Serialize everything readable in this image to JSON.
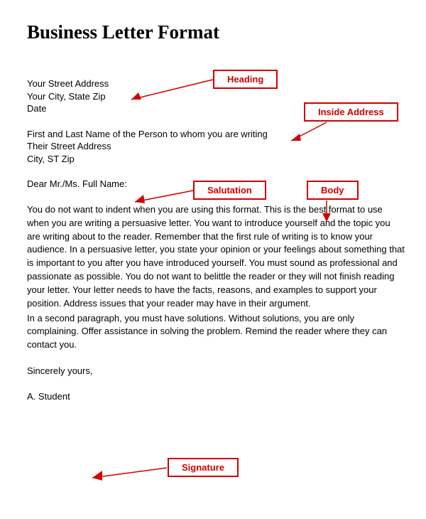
{
  "title": "Business Letter Format",
  "heading": {
    "line1": "Your Street Address",
    "line2": "Your City, State  Zip",
    "line3": "Date"
  },
  "inside_address": {
    "line1": "First and Last Name of the Person to whom you are writing",
    "line2": "Their Street Address",
    "line3": "City, ST Zip"
  },
  "salutation": "Dear Mr./Ms. Full Name:",
  "body": {
    "p1": "You do not want to indent when you are using this format.  This is the best format to use when you are writing a persuasive letter.    You want to introduce yourself and the topic you are writing about to the reader.  Remember that the first rule of writing is to know your audience.  In a persuasive letter, you state your opinion or your feelings about something that is important to you after you have introduced yourself.  You must sound as professional and passionate as possible.  You do not want to belittle the reader or they will not finish reading your letter.  Your letter needs to have the facts, reasons, and examples to support your position. Address issues that your reader may have in their argument.",
    "p2": "In a second paragraph, you must have solutions.  Without solutions, you are only complaining. Offer assistance in solving the problem.  Remind the reader where they can contact you."
  },
  "closing": "Sincerely yours,",
  "signature": "A. Student",
  "labels": {
    "heading": "Heading",
    "inside_address": "Inside Address",
    "salutation": "Salutation",
    "body": "Body",
    "signature": "Signature"
  }
}
